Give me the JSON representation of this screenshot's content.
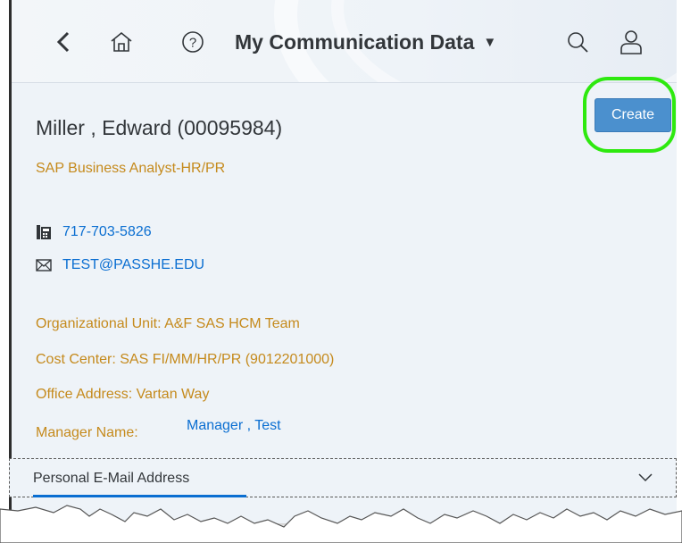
{
  "shell": {
    "title": "My Communication Data",
    "back_icon": "chevron-left-icon",
    "home_icon": "home-icon",
    "help_icon": "help-icon",
    "caret_icon": "caret-down-icon",
    "search_icon": "search-icon",
    "user_icon": "user-icon"
  },
  "employee": {
    "name": "Miller , Edward (00095984)",
    "job_title": "SAP Business Analyst-HR/PR",
    "phone": "717-703-5826",
    "email": "TEST@PASSHE.EDU",
    "org_unit": "Organizational Unit: A&F SAS HCM Team",
    "cost_center": "Cost Center: SAS FI/MM/HR/PR (9012201000)",
    "office_address": "Office Address: Vartan Way",
    "manager_label": "Manager Name:",
    "manager_name": "Manager , Test"
  },
  "actions": {
    "create_label": "Create"
  },
  "section": {
    "label": "Personal E-Mail Address",
    "icon": "chevron-down-icon"
  },
  "colors": {
    "accent": "#0a6ed1",
    "label_gold": "#c58a1c",
    "button_blue": "#4b90ce",
    "highlight_green": "#2ee90f",
    "background": "#eef3f8"
  }
}
